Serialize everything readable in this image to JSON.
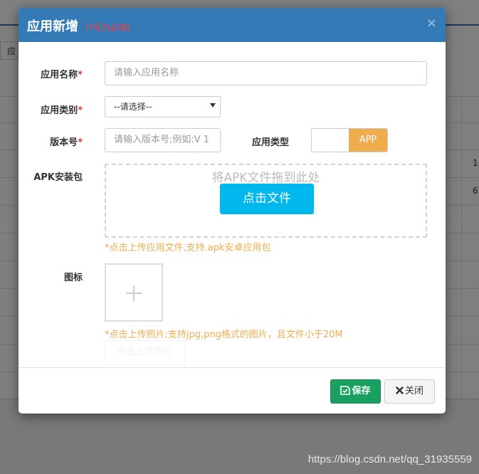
{
  "background": {
    "tab_text": "应",
    "right_cells": [
      "1",
      "6"
    ]
  },
  "modal": {
    "title": "应用新增",
    "required_hint": "(*号为必填)",
    "close_symbol": "×"
  },
  "form": {
    "app_name": {
      "label": "应用名称",
      "required_mark": "*",
      "placeholder": "请输入应用名称"
    },
    "app_category": {
      "label": "应用类别",
      "required_mark": "*",
      "selected": "--请选择--"
    },
    "version": {
      "label": "版本号",
      "required_mark": "*",
      "placeholder": "请输入版本号;例如:V 1"
    },
    "app_type": {
      "label": "应用类型",
      "tag": "APP"
    },
    "apk": {
      "label": "APK安装包",
      "drop_text": "将APK文件拖到此处",
      "button_label": "点击文件",
      "tip": "*点击上传应用文件,支持.apk安卓应用包"
    },
    "icon": {
      "label": "图标",
      "tip": "*点击上传照片;支持jpg,png格式的图片，且文件小于20M",
      "ghost_button": "点击上传图片"
    }
  },
  "footer": {
    "save_label": "保存",
    "close_label": "关闭"
  },
  "watermark": "https://blog.csdn.net/qq_31935559",
  "colors": {
    "header": "#337ab7",
    "save": "#1aa061",
    "accent_orange": "#f0ad4e",
    "upload_button": "#00b7ee",
    "required": "#e03c3c"
  }
}
